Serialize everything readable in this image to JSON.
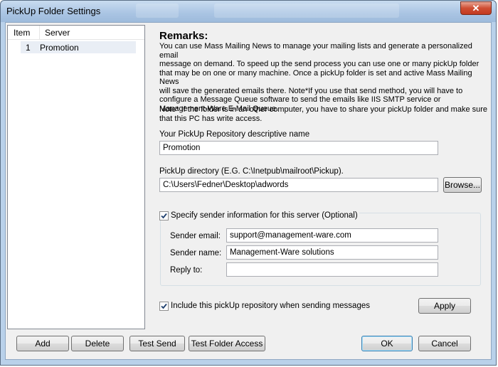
{
  "window": {
    "title": "PickUp Folder Settings",
    "close_glyph": "✕"
  },
  "list": {
    "columns": [
      "Item",
      "Server"
    ],
    "rows": [
      {
        "item": "1",
        "server": "Promotion"
      }
    ]
  },
  "remarks": {
    "title": "Remarks:",
    "lines": [
      "You can use Mass Mailing News to manage your mailing lists and generate a personalized email",
      "message on demand. To speed up the send process you can use one or many pickUp folder",
      "that may be on one or many machine. Once a pickUp folder is set and active Mass Mailing News",
      "will save the generated emails there. Note*If you use that send method, you will have to",
      "configure a Message Queue software to send the emails like IIS SMTP service or",
      "Management-Ware E-Mail Queue."
    ],
    "note_lines": [
      "Note* If the folder is in an other computer, you have to share your pickUp folder and make sure",
      "that this PC has write access."
    ]
  },
  "form": {
    "name_label": "Your PickUp Repository descriptive name",
    "name_value": "Promotion",
    "dir_label": "PickUp directory (E.G. C:\\Inetpub\\mailroot\\Pickup).",
    "dir_value": "C:\\Users\\Fedner\\Desktop\\adwords",
    "browse_label": "Browse...",
    "sender_checkbox_label": "Specify sender information for this server (Optional)",
    "sender_checked": true,
    "sender_email_label": "Sender email:",
    "sender_email_value": "support@management-ware.com",
    "sender_name_label": "Sender name:",
    "sender_name_value": "Management-Ware solutions",
    "reply_to_label": "Reply to:",
    "reply_to_value": "",
    "include_checkbox_label": "Include this pickUp repository when sending messages",
    "include_checked": true,
    "apply_label": "Apply"
  },
  "footer": {
    "add_label": "Add",
    "delete_label": "Delete",
    "test_send_label": "Test Send",
    "test_folder_label": "Test Folder Access",
    "ok_label": "OK",
    "cancel_label": "Cancel"
  }
}
